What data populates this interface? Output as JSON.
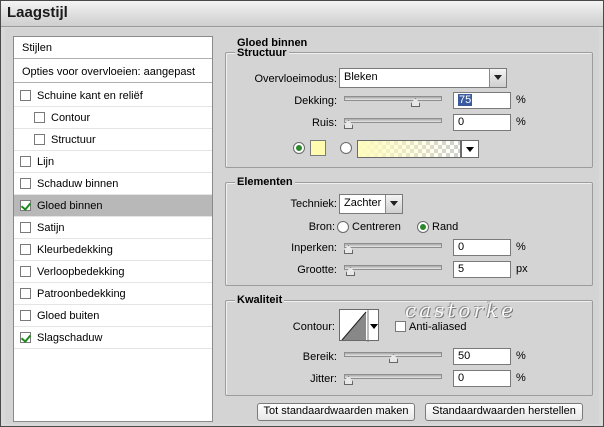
{
  "window": {
    "title": "Laagstijl"
  },
  "sidebar": {
    "header": "Stijlen",
    "blend_options": "Opties voor overvloeien: aangepast",
    "items": [
      {
        "label": "Schuine kant en reliëf",
        "checked": false,
        "indent": false
      },
      {
        "label": "Contour",
        "checked": false,
        "indent": true
      },
      {
        "label": "Structuur",
        "checked": false,
        "indent": true
      },
      {
        "label": "Lijn",
        "checked": false,
        "indent": false
      },
      {
        "label": "Schaduw binnen",
        "checked": false,
        "indent": false
      },
      {
        "label": "Gloed binnen",
        "checked": true,
        "indent": false,
        "selected": true
      },
      {
        "label": "Satijn",
        "checked": false,
        "indent": false
      },
      {
        "label": "Kleurbedekking",
        "checked": false,
        "indent": false
      },
      {
        "label": "Verloopbedekking",
        "checked": false,
        "indent": false
      },
      {
        "label": "Patroonbedekking",
        "checked": false,
        "indent": false
      },
      {
        "label": "Gloed buiten",
        "checked": false,
        "indent": false
      },
      {
        "label": "Slagschaduw",
        "checked": true,
        "indent": false
      }
    ]
  },
  "panel": {
    "section_title": "Gloed binnen",
    "structure": {
      "legend": "Structuur",
      "blend_mode_label": "Overvloeimodus:",
      "blend_mode_value": "Bleken",
      "opacity_label": "Dekking:",
      "opacity_value": "75",
      "opacity_unit": "%",
      "opacity_fraction": 0.75,
      "noise_label": "Ruis:",
      "noise_value": "0",
      "noise_unit": "%",
      "noise_fraction": 0,
      "color_swatch": "#fffcb0",
      "color_selected": "solid"
    },
    "elements": {
      "legend": "Elementen",
      "technique_label": "Techniek:",
      "technique_value": "Zachter",
      "source_label": "Bron:",
      "source_center": "Centreren",
      "source_edge": "Rand",
      "source_selected": "edge",
      "choke_label": "Inperken:",
      "choke_value": "0",
      "choke_unit": "%",
      "choke_fraction": 0,
      "size_label": "Grootte:",
      "size_value": "5",
      "size_unit": "px",
      "size_fraction": 0.02
    },
    "quality": {
      "legend": "Kwaliteit",
      "contour_label": "Contour:",
      "anti_aliased_label": "Anti-aliased",
      "anti_aliased": false,
      "range_label": "Bereik:",
      "range_value": "50",
      "range_unit": "%",
      "range_fraction": 0.5,
      "jitter_label": "Jitter:",
      "jitter_value": "0",
      "jitter_unit": "%",
      "jitter_fraction": 0
    },
    "buttons": {
      "make_default": "Tot standaardwaarden maken",
      "reset_default": "Standaardwaarden herstellen"
    }
  },
  "watermark": "castorke",
  "colors": {
    "accent_check": "#1d8a1d",
    "selected_row": "#b8b8b8",
    "glow": "#fffcb0"
  }
}
